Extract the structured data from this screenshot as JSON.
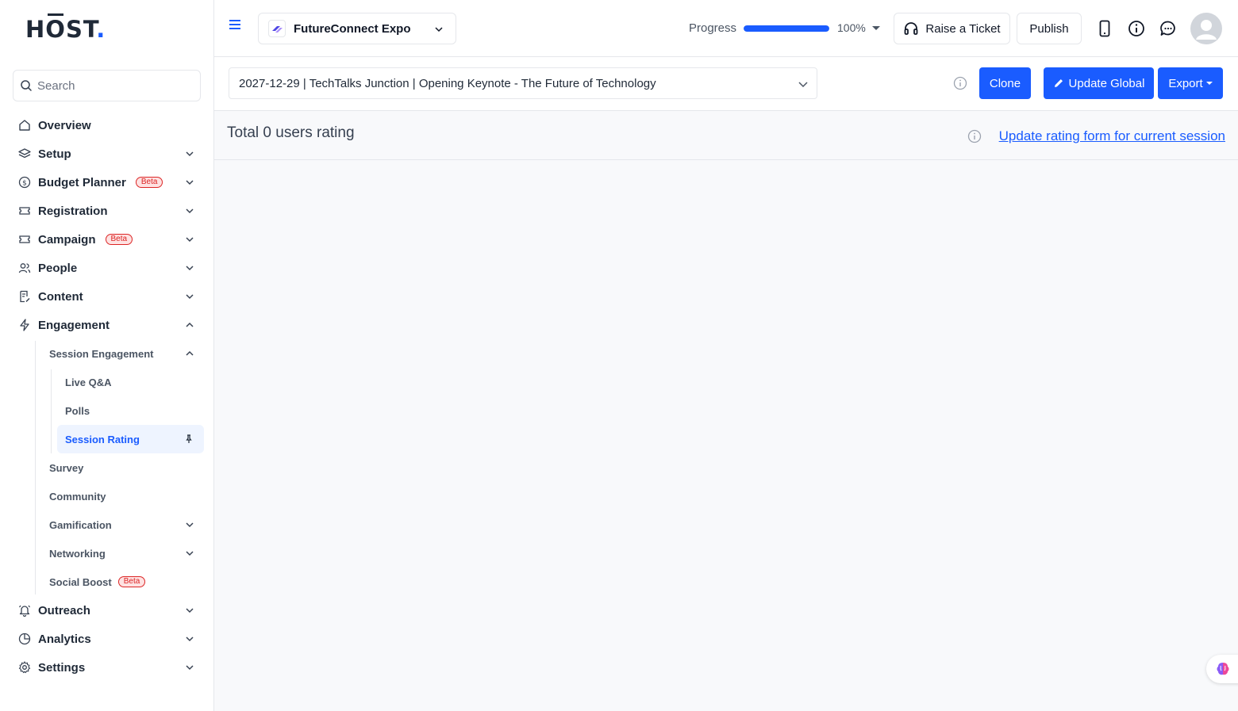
{
  "brand": {
    "logo_text": "HŌST",
    "logo_dot": "."
  },
  "search": {
    "placeholder": "Search"
  },
  "nav": {
    "overview": "Overview",
    "setup": "Setup",
    "budget_planner": "Budget Planner",
    "registration": "Registration",
    "campaign": "Campaign",
    "people": "People",
    "content": "Content",
    "engagement": "Engagement",
    "outreach": "Outreach",
    "analytics": "Analytics",
    "settings": "Settings",
    "beta": "Beta"
  },
  "engagement": {
    "session_engagement": "Session Engagement",
    "live_qa": "Live Q&A",
    "polls": "Polls",
    "session_rating": "Session Rating",
    "survey": "Survey",
    "community": "Community",
    "gamification": "Gamification",
    "networking": "Networking",
    "social_boost": "Social Boost"
  },
  "topbar": {
    "event_name": "FutureConnect Expo",
    "progress_label": "Progress",
    "progress_value": "100%",
    "progress_percent": 100,
    "raise_ticket": "Raise a Ticket",
    "publish": "Publish"
  },
  "session": {
    "selected": "2027-12-29 | TechTalks Junction | Opening Keynote - The Future of Technology",
    "clone": "Clone",
    "update_global": "Update Global",
    "export": "Export"
  },
  "main": {
    "total_label": "Total 0 users rating",
    "update_link": "Update rating form for current session"
  },
  "colors": {
    "accent": "#1a5cff",
    "badge": "#dc2626"
  }
}
